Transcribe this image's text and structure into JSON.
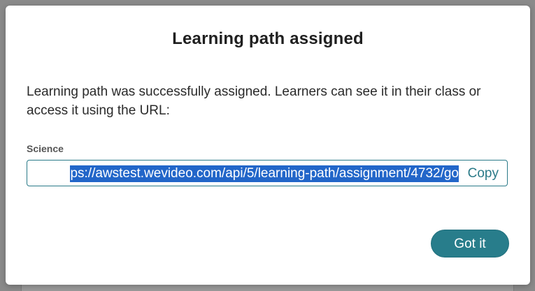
{
  "dialog": {
    "title": "Learning path assigned",
    "message": "Learning path was successfully assigned. Learners can see it in their class or access it using the URL:",
    "field_label": "Science",
    "url_visible": "ps://awstest.wevideo.com/api/5/learning-path/assignment/4732/go",
    "copy_label": "Copy",
    "confirm_label": "Got it"
  },
  "colors": {
    "accent": "#287d8b",
    "selection": "#2266c9",
    "backdrop": "#8a8a8a"
  }
}
